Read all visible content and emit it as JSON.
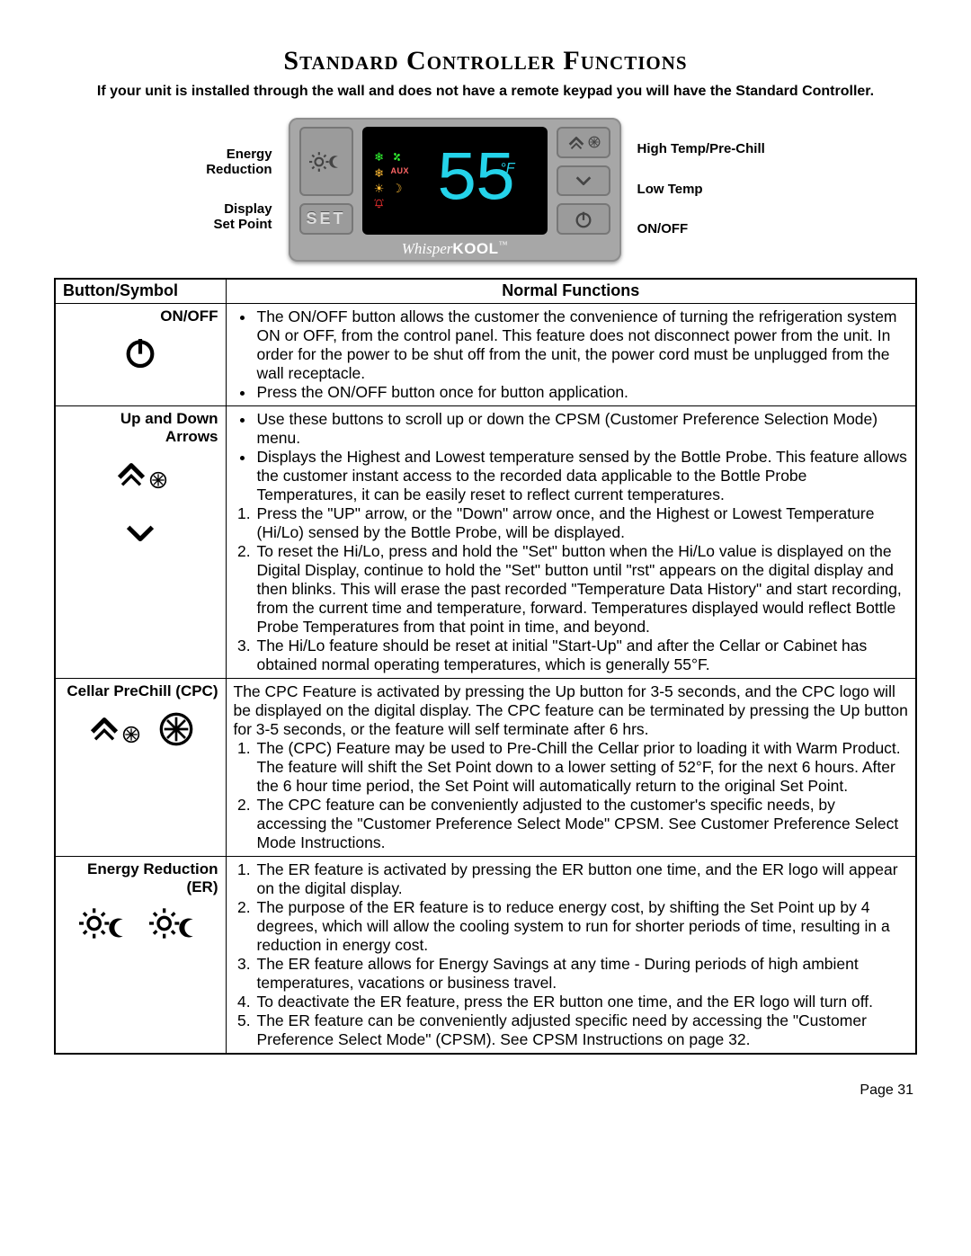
{
  "title": "Standard Controller Functions",
  "intro": "If your unit is installed through the wall and does not have a remote keypad you will have the Standard Controller.",
  "figure": {
    "left_labels": [
      {
        "line1": "Energy",
        "line2": "Reduction"
      },
      {
        "line1": "Display",
        "line2": "Set Point"
      }
    ],
    "right_labels": [
      {
        "line1": "High Temp/Pre-Chill"
      },
      {
        "line1": "Low Temp"
      },
      {
        "line1": "ON/OFF"
      }
    ],
    "set_label": "SET",
    "readout": "55",
    "unit": "°F",
    "aux_label": "AUX",
    "brand_script": "Whisper",
    "brand_bold": "KOOL",
    "brand_tm": "™"
  },
  "table": {
    "headers": {
      "left": "Button/Symbol",
      "right": "Normal Functions"
    },
    "rows": [
      {
        "symbol_title": "ON/OFF",
        "icons": [
          "power"
        ],
        "bullets": [
          "The ON/OFF button allows the customer the convenience of turning the refrigeration system ON or OFF, from the control panel.  This feature does not disconnect power from the unit.  In order for the power to be shut off from the unit, the power cord must be unplugged from the wall receptacle.",
          "Press the ON/OFF button once for button application."
        ]
      },
      {
        "symbol_title_line1": "Up and Down",
        "symbol_title_line2": "Arrows",
        "icons": [
          "up-snow",
          "down"
        ],
        "bullets": [
          "Use these buttons to scroll up or down the CPSM (Customer Preference Selection Mode) menu.",
          "Displays the Highest and Lowest temperature sensed by the Bottle Probe.  This feature allows the customer instant access to the recorded data applicable to the Bottle Probe Temperatures, it can be easily reset to reflect current temperatures."
        ],
        "numbered": [
          "Press the \"UP\" arrow, or the \"Down\" arrow once, and the Highest or Lowest Temperature (Hi/Lo) sensed by the Bottle Probe, will be displayed.",
          "To reset the Hi/Lo, press and hold the \"Set\" button when the Hi/Lo value is displayed on the Digital Display, continue to hold the \"Set\" button until \"rst\" appears on the digital display and then blinks.  This will erase the past recorded \"Temperature Data History\" and start recording, from the current time and temperature, forward.  Temperatures displayed would reflect Bottle Probe Temperatures from that point in time, and beyond.",
          "The Hi/Lo feature should be reset at initial \"Start-Up\" and after the Cellar or Cabinet has obtained normal operating temperatures, which is generally 55°F."
        ]
      },
      {
        "symbol_title": "Cellar PreChill (CPC)",
        "icons": [
          "up-snow",
          "snow-badge"
        ],
        "paragraph": "The CPC Feature is activated by pressing the Up button for 3-5 seconds, and the CPC logo will be displayed on the digital display.  The CPC feature can be terminated by pressing the Up button for 3-5 seconds, or the feature will self terminate after 6 hrs.",
        "numbered": [
          "The (CPC) Feature may be used to Pre-Chill the Cellar prior to loading it with Warm Product.  The feature will shift the Set Point down to a lower setting of 52°F, for the next 6 hours.  After the 6 hour time period, the Set Point will automatically return to the original Set Point.",
          "The CPC feature can be conveniently adjusted to the customer's specific needs, by accessing the \"Customer Preference Select Mode\" CPSM.  See Customer Preference Select Mode Instructions."
        ]
      },
      {
        "symbol_title_line1": "Energy Reduction",
        "symbol_title_line2": "(ER)",
        "icons": [
          "sun-moon",
          "sun-moon-bold"
        ],
        "numbered": [
          "The ER feature is activated by pressing the ER button one time, and the ER logo will appear on the digital display.",
          "The purpose of the ER feature is to reduce energy cost, by shifting the Set Point up by 4 degrees, which will allow the cooling system to run for shorter periods of time, resulting in a reduction in energy cost.",
          "The ER feature allows for Energy Savings at any time - During periods of high ambient temperatures, vacations or business travel.",
          "To deactivate the ER feature, press the ER button one time, and the ER logo will turn off.",
          "The ER feature can be conveniently adjusted specific need by accessing the \"Customer Preference Select Mode\" (CPSM).  See CPSM Instructions on page 32."
        ]
      }
    ]
  },
  "page_label": "Page 31"
}
